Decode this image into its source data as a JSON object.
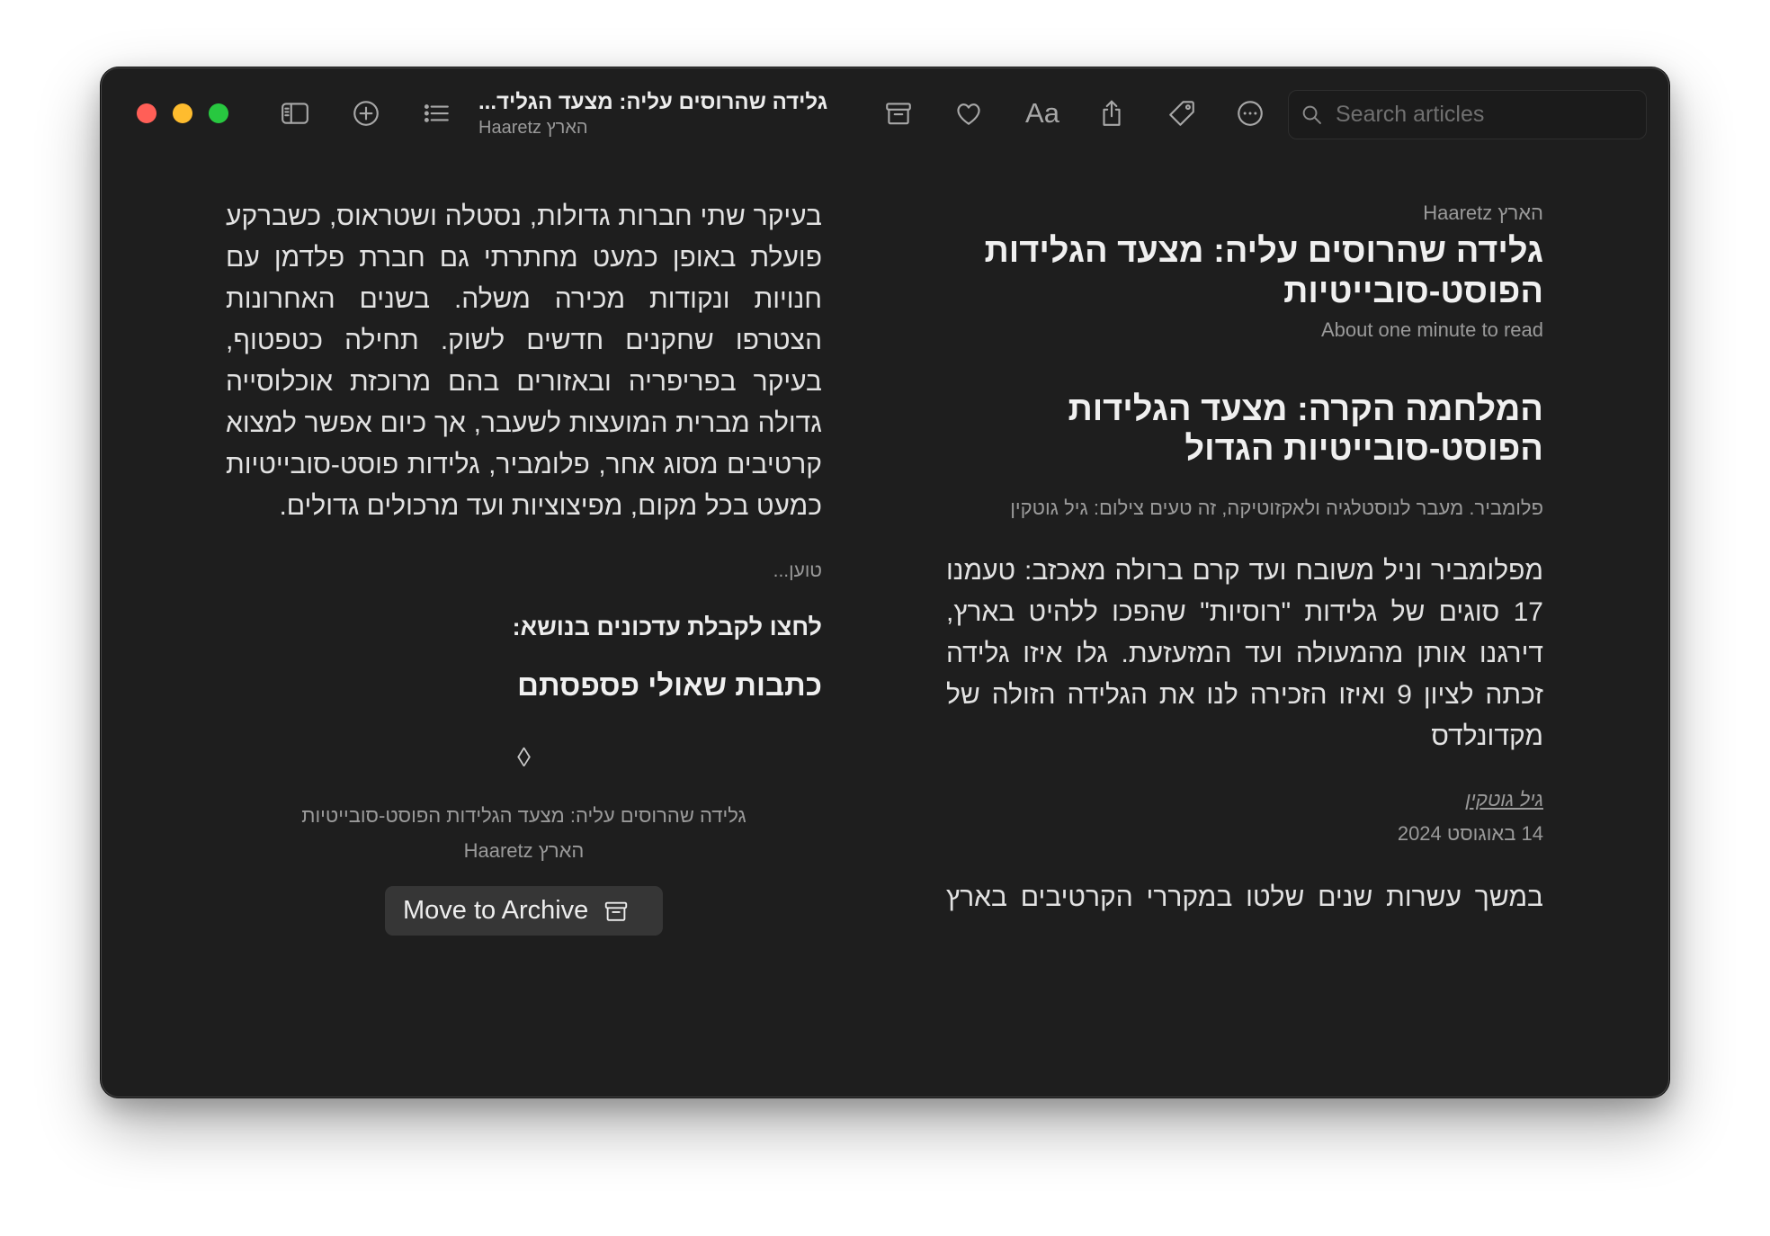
{
  "window": {
    "traffic_lights": {
      "close": "#ff5f57",
      "minimize": "#febc2e",
      "zoom": "#28c840"
    },
    "theme": {
      "background": "#1e1e1e",
      "text": "#e2e2e2",
      "secondary_text": "#9a9a9a",
      "button_background": "#363636"
    }
  },
  "toolbar": {
    "icons": [
      "sidebar-icon",
      "add-circle-icon",
      "list-icon",
      "archive-icon",
      "heart-icon",
      "text-format-icon",
      "share-icon",
      "tag-icon",
      "more-circle-icon",
      "search-icon"
    ],
    "article_title": "גלידה שהרוסים עליה: מצעד הגליד...",
    "article_source": "Haaretz הארץ",
    "text_format_label": "Aa",
    "search": {
      "placeholder": "Search articles",
      "value": ""
    }
  },
  "article": {
    "source": "Haaretz הארץ",
    "title": "גלידה שהרוסים עליה: מצעד הגלידות הפוסט-סובייטיות",
    "reading_time": "About one minute to read",
    "headline": "המלחמה הקרה: מצעד הגלידות הפוסט-סובייטיות הגדול",
    "image_caption": "פלומביר. מעבר לנוסטלגיה ולאקזוטיקה, זה טעים צילום: גיל גוטקין",
    "lead": "מפלומביר וניל משובח ועד קרם ברולה מאכזב: טעמנו 17 סוגים של גלידות \"רוסיות\" שהפכו ללהיט בארץ, דירגנו אותן מהמעולה ועד המזעזעת. גלו איזו גלידה זכתה לציון 9 ואיזו הזכירה לנו את הגלידה הזולה של מקדונלדס",
    "author": "גיל גוטקין",
    "date": "14 באוגוסט 2024",
    "body_columns": [
      "במשך עשרות שנים שלטו במקררי הקרטיבים בארץ",
      "בעיקר שתי חברות גדולות, נסטלה ושטראוס, כשברקע פועלת באופן כמעט מחתרתי גם חברת פלדמן עם חנויות ונקודות מכירה משלה. בשנים האחרונות הצטרפו שחקנים חדשים לשוק. תחילה כטפטוף, בעיקר בפריפריה ובאזורים בהם מרוכזת אוכלוסייה גדולה מברית המועצות לשעבר, אך כיום אפשר למצוא קרטיבים מסוג אחר, פלומביר, גלידות פוסט-סובייטיות כמעט בכל מקום, מפיצוציות ועד מרכולים גדולים."
    ],
    "loading_text": "טוען...",
    "updates_prompt": "לחצו לקבלת עדכונים בנושא:",
    "more_articles_heading": "כתבות שאולי פספסתם",
    "end_marker": "◊"
  },
  "footer": {
    "title": "גלידה שהרוסים עליה: מצעד הגלידות הפוסט-סובייטיות",
    "source": "Haaretz הארץ",
    "archive_button_label": "Move to Archive"
  }
}
